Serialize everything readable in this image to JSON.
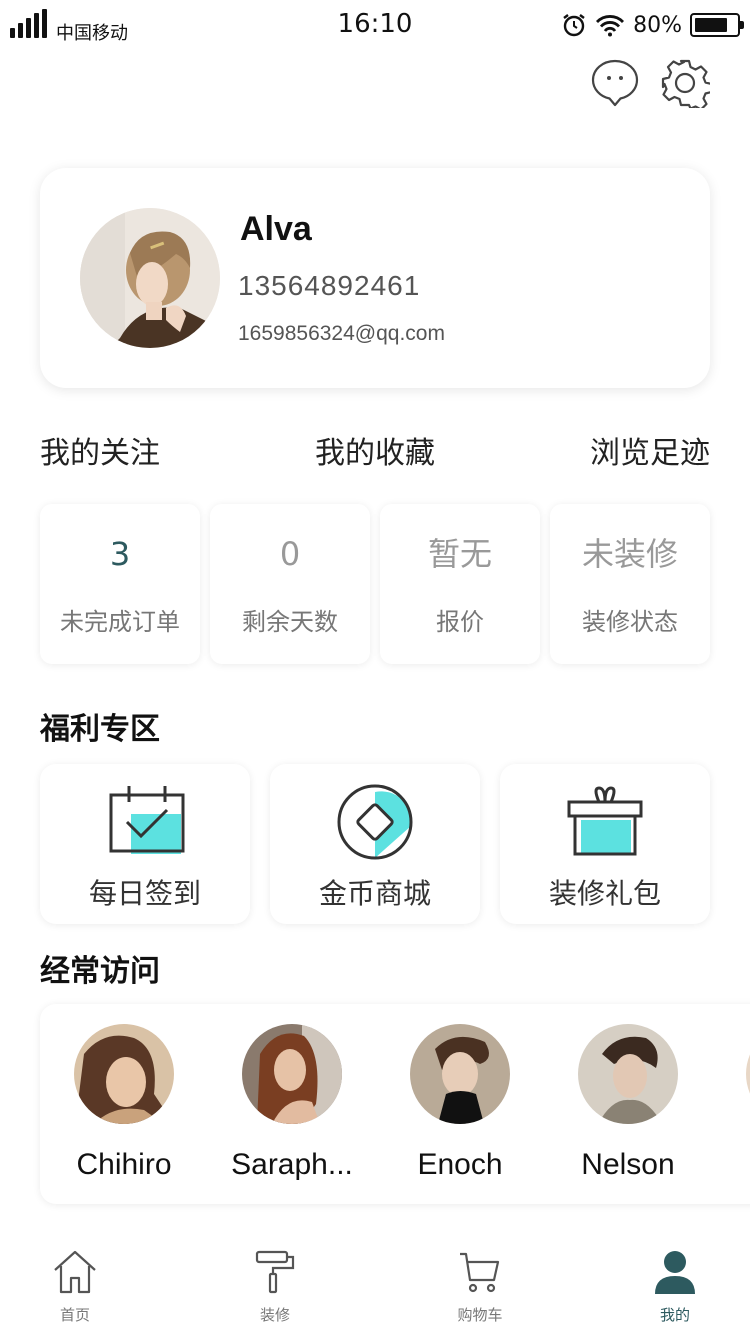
{
  "status_bar": {
    "carrier": "中国移动",
    "time": "16:10",
    "battery": "80%",
    "battery_level": 0.8
  },
  "profile": {
    "name": "Alva",
    "phone": "13564892461",
    "email": "1659856324@qq.com"
  },
  "quick_links": [
    "我的关注",
    "我的收藏",
    "浏览足迹"
  ],
  "stats": [
    {
      "value": "3",
      "label": "未完成订单"
    },
    {
      "value": "0",
      "label": "剩余天数"
    },
    {
      "value": "暂无",
      "label": "报价"
    },
    {
      "value": "未装修",
      "label": "装修状态"
    }
  ],
  "benefits": {
    "title": "福利专区",
    "items": [
      {
        "label": "每日签到",
        "icon": "calendar-check-icon"
      },
      {
        "label": "金币商城",
        "icon": "coin-diamond-icon"
      },
      {
        "label": "装修礼包",
        "icon": "gift-icon"
      }
    ]
  },
  "frequent": {
    "title": "经常访问",
    "users": [
      {
        "name": "Chihiro"
      },
      {
        "name": "Saraph..."
      },
      {
        "name": "Enoch"
      },
      {
        "name": "Nelson"
      }
    ]
  },
  "tabbar": [
    {
      "label": "首页",
      "icon": "home-icon"
    },
    {
      "label": "装修",
      "icon": "paint-roller-icon"
    },
    {
      "label": "购物车",
      "icon": "cart-icon"
    },
    {
      "label": "我的",
      "icon": "person-icon",
      "active": true
    }
  ],
  "colors": {
    "accent": "#2d5a5f",
    "icon_fill": "#5ce1e0"
  }
}
